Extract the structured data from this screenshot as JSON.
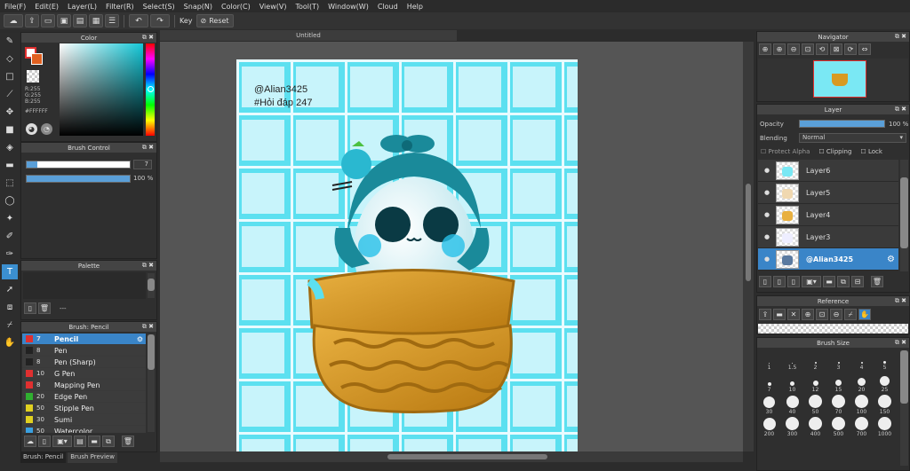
{
  "menu": [
    "File(F)",
    "Edit(E)",
    "Layer(L)",
    "Filter(R)",
    "Select(S)",
    "Snap(N)",
    "Color(C)",
    "View(V)",
    "Tool(T)",
    "Window(W)",
    "Cloud",
    "Help"
  ],
  "toolbar": {
    "key_label": "Key",
    "reset_label": "Reset"
  },
  "color_panel": {
    "title": "Color",
    "r": "R:255",
    "g": "G:255",
    "b": "B:255",
    "hex": "#FFFFFF"
  },
  "brush_control": {
    "title": "Brush Control",
    "size": "7",
    "opacity": "100 %"
  },
  "palette": {
    "title": "Palette",
    "dots": "---"
  },
  "brush_panel": {
    "title": "Brush: Pencil",
    "items": [
      {
        "size": "7",
        "name": "Pencil",
        "color": "#e03030",
        "selected": true
      },
      {
        "size": "8",
        "name": "Pen",
        "color": "#222222"
      },
      {
        "size": "8",
        "name": "Pen (Sharp)",
        "color": "#222222"
      },
      {
        "size": "10",
        "name": "G Pen",
        "color": "#e03030"
      },
      {
        "size": "8",
        "name": "Mapping Pen",
        "color": "#e03030"
      },
      {
        "size": "20",
        "name": "Edge Pen",
        "color": "#30b030"
      },
      {
        "size": "50",
        "name": "Stipple Pen",
        "color": "#e0d020"
      },
      {
        "size": "30",
        "name": "Sumi",
        "color": "#e0d020"
      },
      {
        "size": "50",
        "name": "Watercolor",
        "color": "#3aa0e0"
      }
    ]
  },
  "bottom_tabs": [
    "Brush: Pencil",
    "Brush Preview"
  ],
  "canvas": {
    "tab_title": "Untitled",
    "text_line1": "@Alian3425",
    "text_line2": "#Hỏi đáp 247"
  },
  "navigator": {
    "title": "Navigator"
  },
  "layer_panel": {
    "title": "Layer",
    "opacity_label": "Opacity",
    "opacity_value": "100 %",
    "blending_label": "Blending",
    "blending_value": "Normal",
    "protect_alpha": "Protect Alpha",
    "clipping": "Clipping",
    "lock": "Lock",
    "layers": [
      {
        "name": "Layer6"
      },
      {
        "name": "Layer5"
      },
      {
        "name": "Layer4"
      },
      {
        "name": "Layer3"
      },
      {
        "name": "@Alian3425",
        "selected": true
      }
    ]
  },
  "reference": {
    "title": "Reference"
  },
  "brush_size": {
    "title": "Brush Size",
    "sizes": [
      "1",
      "1.5",
      "2",
      "3",
      "4",
      "5",
      "7",
      "10",
      "12",
      "15",
      "20",
      "25",
      "30",
      "40",
      "50",
      "70",
      "100",
      "150",
      "200",
      "300",
      "400",
      "500",
      "700",
      "1000"
    ]
  },
  "colors": {
    "accent": "#3a85c8",
    "tile_bg": "#5ce0f0",
    "tile": "#c8f4fb",
    "basket": "#d89a22",
    "teal": "#1a8a9a"
  }
}
